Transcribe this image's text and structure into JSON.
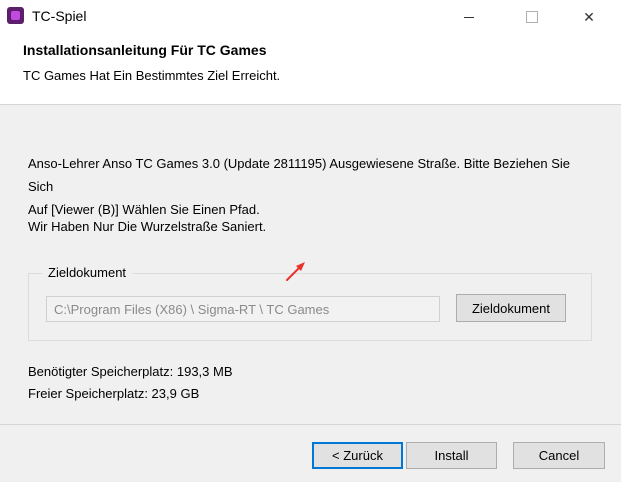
{
  "window": {
    "title": "TC-Spiel",
    "controls": {
      "minimize_icon": "minimize-icon",
      "maximize_icon": "maximize-icon",
      "close_icon": "close-icon",
      "close_glyph": "✕"
    }
  },
  "header": {
    "title": "Installationsanleitung Für TC Games",
    "subtitle": "TC Games Hat Ein Bestimmtes Ziel Erreicht."
  },
  "body": {
    "description_line1": "Anso-Lehrer Anso TC Games 3.0 (Update 2811195) Ausgewiesene Straße. Bitte Beziehen Sie Sich",
    "description_line2": "Auf [Viewer (B)] Wählen Sie Einen Pfad.",
    "description2": "Wir Haben Nur Die Wurzelstraße Saniert."
  },
  "destination": {
    "group_label": "Zieldokument",
    "path_value": "C:\\Program Files (X86) \\ Sigma-RT \\ TC Games",
    "browse_label": "Zieldokument",
    "arrow_color": "#e8322b"
  },
  "space": {
    "required": "Benötigter Speicherplatz: 193,3 MB",
    "free": "Freier Speicherplatz: 23,9 GB"
  },
  "footer": {
    "back_label": "< Zurück",
    "install_label": "Install",
    "cancel_label": "Cancel"
  },
  "colors": {
    "accent": "#0078d7",
    "app_icon": "#5b1f6b"
  }
}
